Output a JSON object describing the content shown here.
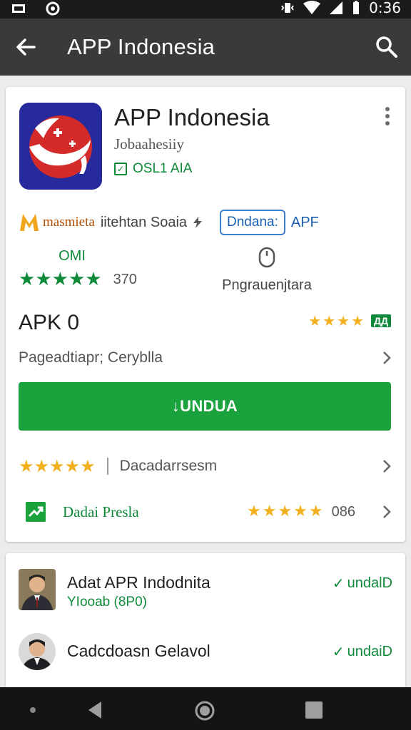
{
  "status_bar": {
    "time": "0:36"
  },
  "app_bar": {
    "title": "APP Indonesia"
  },
  "app": {
    "name": "APP Indonesia",
    "developer": "Jobaahesiiy",
    "badge_text": "OSL1 AIA",
    "colors": {
      "icon_bg": "#262a9c",
      "icon_red": "#d42a2a",
      "brand_green": "#1aa33c"
    }
  },
  "tags": {
    "brand": "masmieta",
    "text": "iitehtan Soaia",
    "pill": "Dndana:",
    "suffix": "APF"
  },
  "rating": {
    "top_label": "OMI",
    "count": "370",
    "stars": 5
  },
  "install": {
    "label": "Pngrauenjtara"
  },
  "apk": {
    "title": "APK 0",
    "mini_badge": "ДД"
  },
  "description_row": {
    "text": "Pageadtiapr; Ceryblla"
  },
  "install_button": {
    "label": "↓UNDUA"
  },
  "reviews_row": {
    "text": "Dacadarrsesm"
  },
  "trend_row": {
    "text": "Dadai Presla",
    "number": "086"
  },
  "related": [
    {
      "title": "Adat APR Indodnita",
      "subtitle": "YIooab (8P0)",
      "action": "undalD"
    },
    {
      "title": "Cadcdoasn Gelavol",
      "subtitle": "",
      "action": "undaiD"
    }
  ]
}
